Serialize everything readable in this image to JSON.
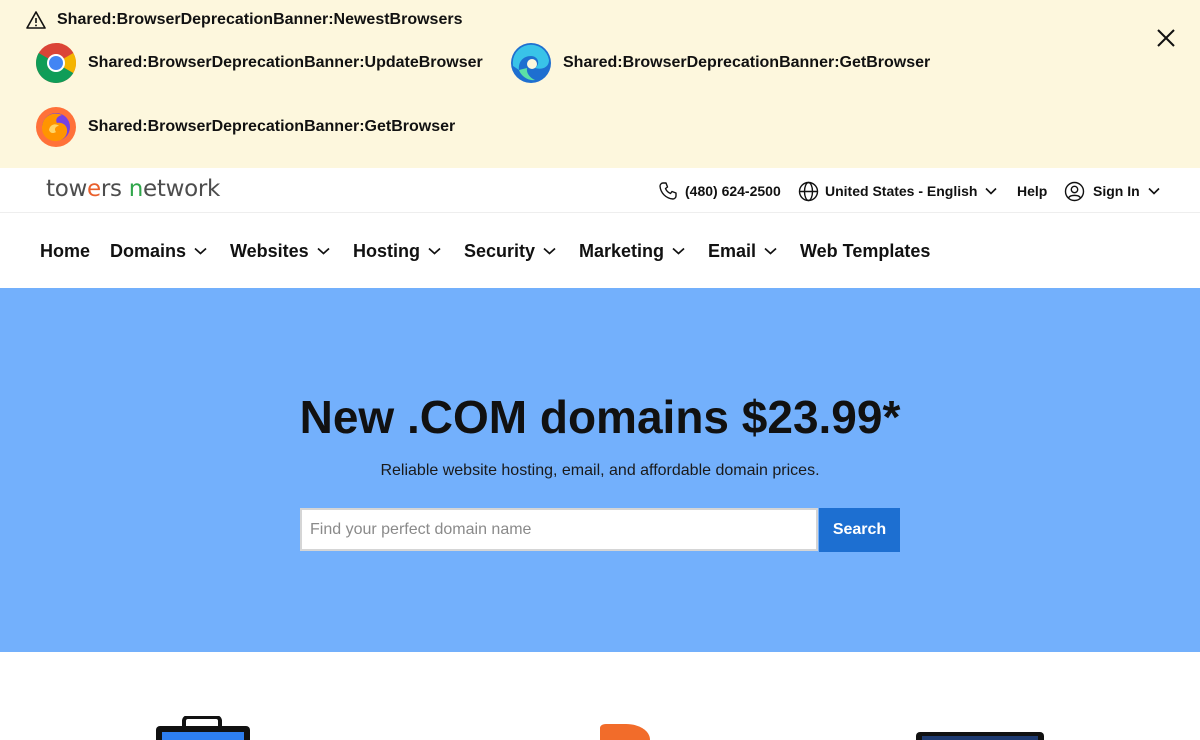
{
  "banner": {
    "title": "Shared:BrowserDeprecationBanner:NewestBrowsers",
    "options": [
      {
        "browser": "chrome",
        "label": "Shared:BrowserDeprecationBanner:UpdateBrowser"
      },
      {
        "browser": "edge",
        "label": "Shared:BrowserDeprecationBanner:GetBrowser"
      },
      {
        "browser": "firefox",
        "label": "Shared:BrowserDeprecationBanner:GetBrowser"
      }
    ],
    "icons": {
      "warning": "warning-icon",
      "close": "close-icon"
    }
  },
  "header": {
    "brand": {
      "part1": "tow",
      "part2": "e",
      "part3": "rs ",
      "part4": "n",
      "part5": "etwork"
    },
    "phone": "(480) 624-2500",
    "locale": "United States - English",
    "help": "Help",
    "sign_in": "Sign In",
    "icons": {
      "phone": "phone-icon",
      "globe": "globe-icon",
      "user": "user-icon",
      "chevron": "chevron-down-icon"
    }
  },
  "nav": {
    "items": [
      {
        "label": "Home",
        "dropdown": false
      },
      {
        "label": "Domains",
        "dropdown": true
      },
      {
        "label": "Websites",
        "dropdown": true
      },
      {
        "label": "Hosting",
        "dropdown": true
      },
      {
        "label": "Security",
        "dropdown": true
      },
      {
        "label": "Marketing",
        "dropdown": true
      },
      {
        "label": "Email",
        "dropdown": true
      },
      {
        "label": "Web Templates",
        "dropdown": false
      }
    ]
  },
  "hero": {
    "title": "New .COM domains $23.99*",
    "subtitle": "Reliable website hosting, email, and affordable domain prices.",
    "search_placeholder": "Find your perfect domain name",
    "search_value": "",
    "search_button": "Search"
  },
  "colors": {
    "banner_bg": "#fdf7dd",
    "hero_bg": "#73b0fc",
    "search_button": "#1d6fd1",
    "brand_orange": "#e95f2b",
    "brand_green": "#2fa64a"
  }
}
